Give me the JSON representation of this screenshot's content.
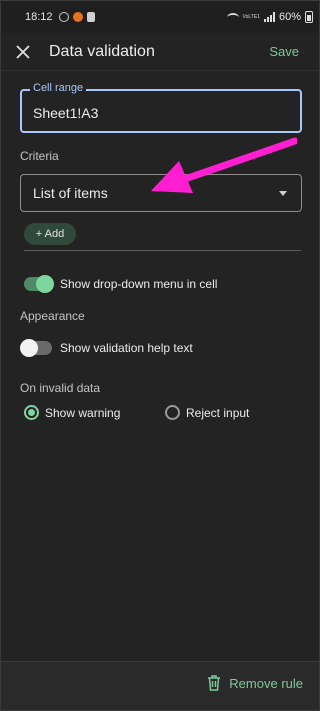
{
  "status_bar": {
    "time": "18:12",
    "lte": "VoLTE1",
    "battery": "60%"
  },
  "app_bar": {
    "title": "Data validation",
    "save_label": "Save"
  },
  "cell_range": {
    "label": "Cell range",
    "value": "Sheet1!A3"
  },
  "criteria": {
    "label": "Criteria",
    "selected": "List of items",
    "add_label": "+ Add"
  },
  "options": {
    "show_dropdown_label": "Show drop-down menu in cell",
    "show_dropdown_on": true
  },
  "appearance": {
    "label": "Appearance",
    "help_text_label": "Show validation help text",
    "help_text_on": false
  },
  "invalid_data": {
    "label": "On invalid data",
    "options": [
      "Show warning",
      "Reject input"
    ],
    "selected": "Show warning"
  },
  "bottom": {
    "remove_label": "Remove rule"
  },
  "colors": {
    "accent_green": "#7fc99a",
    "focus_blue": "#a8c7fa",
    "annotation_arrow": "#ff1fd0"
  }
}
